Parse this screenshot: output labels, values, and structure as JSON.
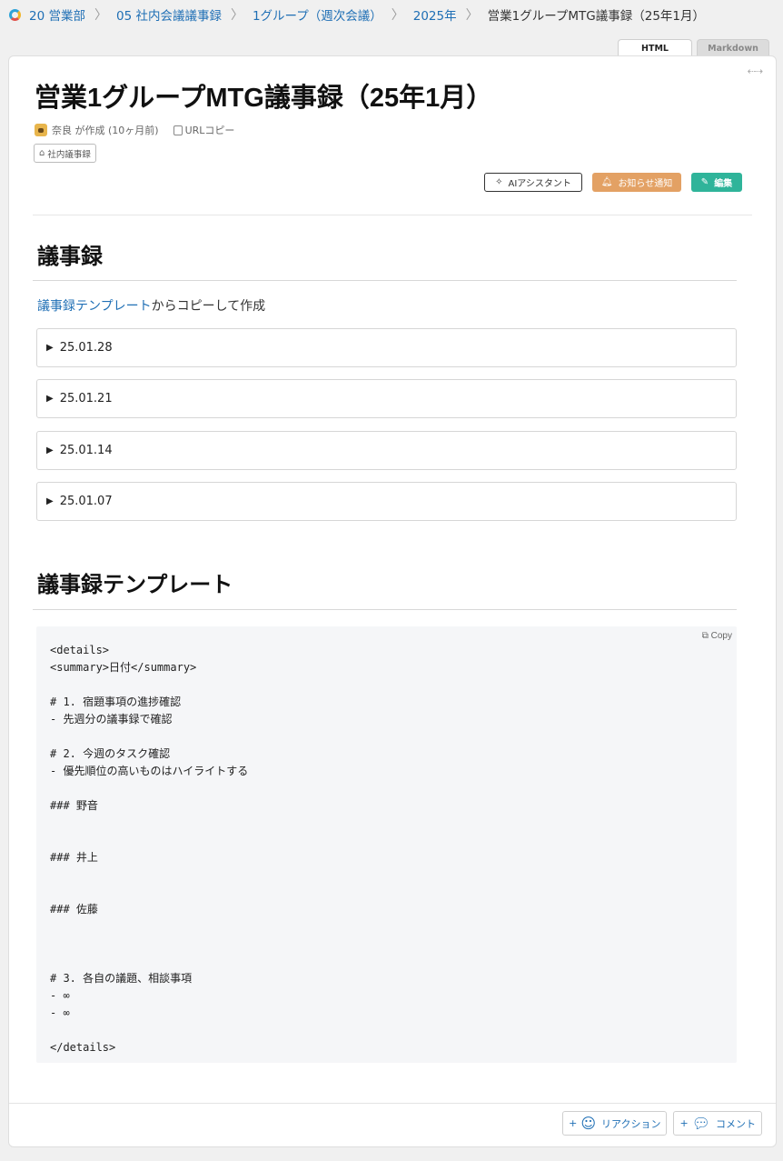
{
  "breadcrumb": {
    "items": [
      "20 営業部",
      "05 社内会議議事録",
      "1グループ（週次会議）",
      "2025年"
    ],
    "current": "営業1グループMTG議事録（25年1月）"
  },
  "tabs": {
    "html": "HTML",
    "markdown": "Markdown"
  },
  "page": {
    "title": "営業1グループMTG議事録（25年1月）",
    "author_line": "奈良 が作成 (10ヶ月前)",
    "copy_url": "URLコピー",
    "tag": "社内議事録"
  },
  "actions": {
    "ai": "AIアシスタント",
    "notify": "お知らせ通知",
    "edit": "編集"
  },
  "section1": {
    "heading": "議事録",
    "intro_link": "議事録テンプレート",
    "intro_rest": "からコピーして作成",
    "details": [
      "25.01.28",
      "25.01.21",
      "25.01.14",
      "25.01.07"
    ]
  },
  "section2": {
    "heading": "議事録テンプレート",
    "copy_label": "Copy",
    "code": "<details>\n<summary>日付</summary>\n\n# 1. 宿題事項の進捗確認\n- 先週分の議事録で確認\n\n# 2. 今週のタスク確認\n- 優先順位の高いものはハイライトする\n\n### 野音\n\n\n### 井上\n\n\n### 佐藤\n\n\n\n# 3. 各自の議題、相談事項\n- ∞\n- ∞\n\n</details>"
  },
  "footer": {
    "reaction": "リアクション",
    "comment": "コメント"
  },
  "colors": {
    "link": "#1f6fb5",
    "notify": "#e3a164",
    "edit": "#2fb49a"
  }
}
